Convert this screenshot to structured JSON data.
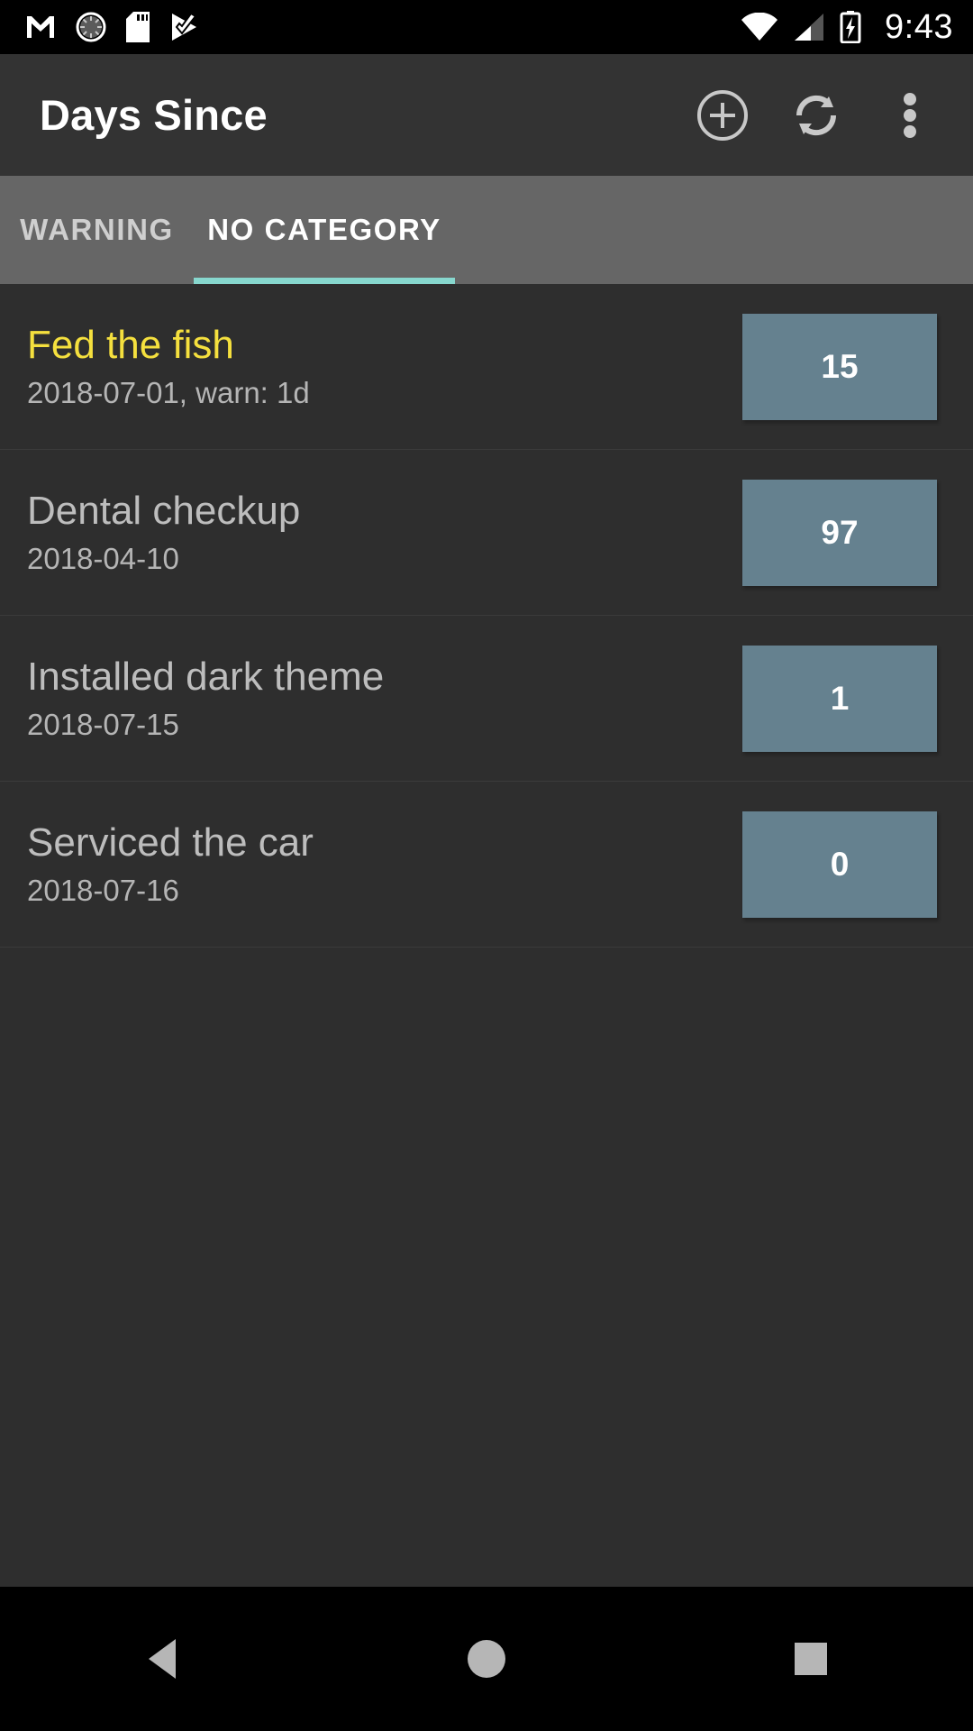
{
  "status_bar": {
    "time": "9:43",
    "left_icons": [
      "gmail-icon",
      "sync-progress-icon",
      "sd-card-icon",
      "tasks-check-icon"
    ],
    "right_icons": [
      "wifi-icon",
      "cell-signal-icon",
      "battery-charging-icon"
    ]
  },
  "app_bar": {
    "title": "Days Since",
    "actions": [
      {
        "name": "add-button",
        "icon": "plus-circle-icon"
      },
      {
        "name": "refresh-button",
        "icon": "refresh-icon"
      },
      {
        "name": "overflow-menu-button",
        "icon": "more-vert-icon"
      }
    ]
  },
  "tabs": {
    "items": [
      {
        "label": "WARNING",
        "active": false
      },
      {
        "label": "NO CATEGORY",
        "active": true
      }
    ],
    "indicator_color": "#87D7CE"
  },
  "list": {
    "items": [
      {
        "title": "Fed the fish",
        "subtitle": "2018-07-01, warn: 1d",
        "count": "15",
        "warning": true
      },
      {
        "title": "Dental checkup",
        "subtitle": "2018-04-10",
        "count": "97",
        "warning": false
      },
      {
        "title": "Installed dark theme",
        "subtitle": "2018-07-15",
        "count": "1",
        "warning": false
      },
      {
        "title": "Serviced the car",
        "subtitle": "2018-07-16",
        "count": "0",
        "warning": false
      }
    ],
    "badge_color": "#65818F",
    "warning_color": "#F5E03E"
  },
  "nav_bar": {
    "buttons": [
      "back-button",
      "home-button",
      "recents-button"
    ]
  }
}
